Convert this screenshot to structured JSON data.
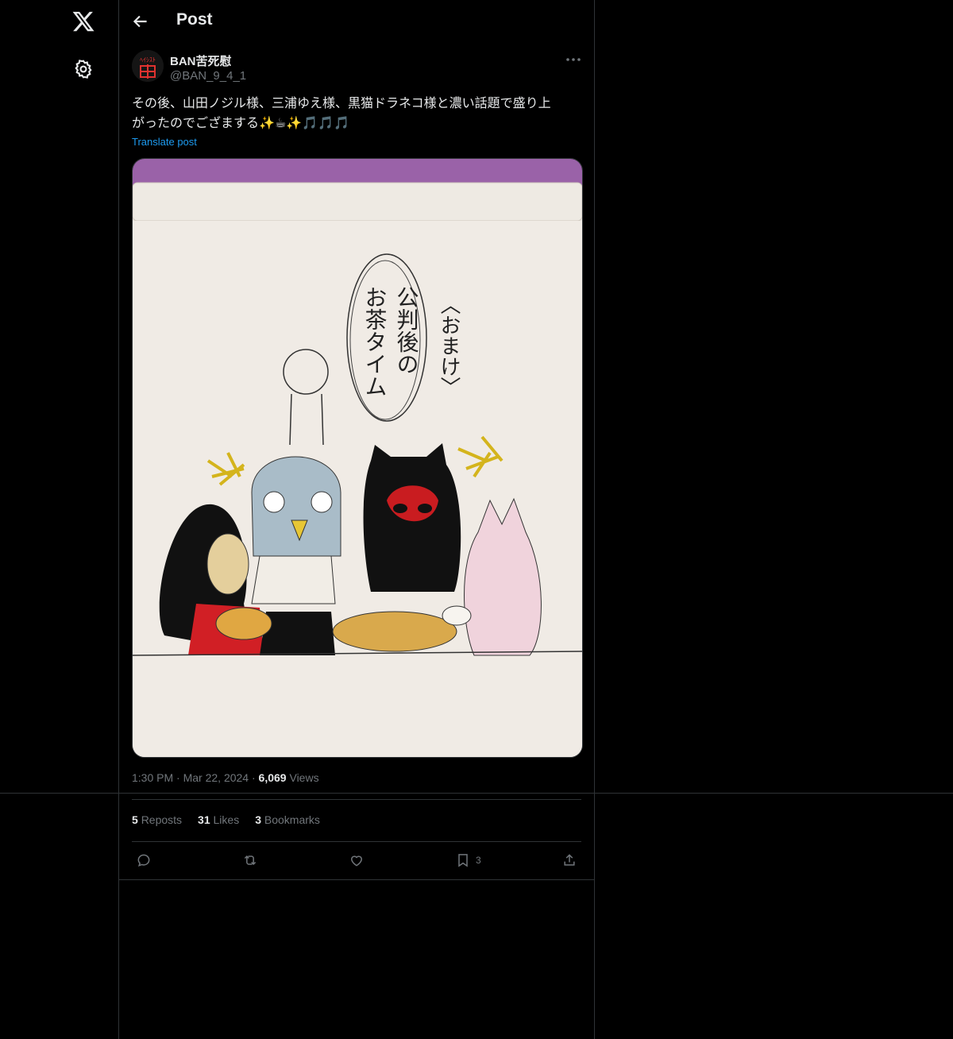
{
  "header": {
    "title": "Post"
  },
  "author": {
    "name": "BAN苦死慰",
    "handle": "@BAN_9_4_1"
  },
  "post": {
    "text_line1": "その後、山田ノジル様、三浦ゆえ様、黒猫ドラネコ様と濃い話題で盛り上",
    "text_line2": "がったのでござまする",
    "emoji_sparkle": "✨",
    "emoji_tea": "☕",
    "emoji_notes": "🎵🎵🎵",
    "translate_label": "Translate post"
  },
  "meta": {
    "time": "1:30 PM",
    "date": "Mar 22, 2024",
    "views_count": "6,069",
    "views_label": "Views"
  },
  "stats": {
    "reposts_count": "5",
    "reposts_label": "Reposts",
    "likes_count": "31",
    "likes_label": "Likes",
    "bookmarks_count": "3",
    "bookmarks_label": "Bookmarks"
  },
  "actions": {
    "bookmark_count": "3"
  },
  "illustration": {
    "bubble_line1": "公判後の",
    "bubble_line2": "お茶タイム",
    "side_label": "〈おまけ〉"
  },
  "icons": {
    "logo": "x-logo-icon",
    "settings": "gear-icon",
    "back": "back-arrow-icon",
    "more": "more-dots-icon",
    "reply": "reply-icon",
    "repost": "repost-icon",
    "like": "heart-icon",
    "bookmark": "bookmark-icon",
    "share": "share-icon"
  },
  "colors": {
    "background": "#000000",
    "text": "#e7e9ea",
    "muted": "#71767b",
    "accent": "#1d9bf0",
    "border": "#2f3336"
  }
}
